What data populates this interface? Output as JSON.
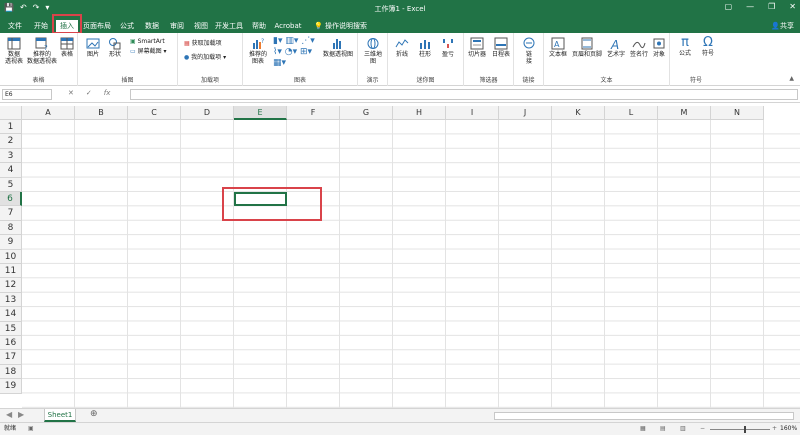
{
  "window": {
    "title": "工作簿1 - Excel"
  },
  "quick_access": {
    "save": "💾",
    "undo": "↶",
    "redo": "↷",
    "more": "▾"
  },
  "window_controls": {
    "options": "▢",
    "minimize": "—",
    "restore": "❐",
    "close": "✕"
  },
  "tabs": [
    "文件",
    "开始",
    "插入",
    "页面布局",
    "公式",
    "数据",
    "审阅",
    "视图",
    "开发工具",
    "帮助",
    "Acrobat"
  ],
  "active_tab": "插入",
  "tell_me": "操作说明搜索",
  "share": "共享",
  "ribbon": {
    "groups": [
      {
        "label": "表格",
        "buttons": [
          "数据\n透视表",
          "推荐的\n数据透视表",
          "表格"
        ]
      },
      {
        "label": "插图",
        "buttons": [
          "图片",
          "形状"
        ],
        "small": [
          "SmartArt",
          "屏幕截图 ▾"
        ]
      },
      {
        "label": "加载项",
        "small": [
          "获取加载项",
          "我的加载项 ▾"
        ]
      },
      {
        "label": "图表",
        "buttons": [
          "推荐的\n图表",
          "数据透视图"
        ]
      },
      {
        "label": "演示",
        "buttons": [
          "三维地\n图"
        ]
      },
      {
        "label": "迷你图",
        "buttons": [
          "折线",
          "柱形",
          "盈亏"
        ]
      },
      {
        "label": "筛选器",
        "buttons": [
          "切片器",
          "日程表"
        ]
      },
      {
        "label": "链接",
        "buttons": [
          "链\n接"
        ]
      },
      {
        "label": "文本",
        "buttons": [
          "文本框",
          "页眉和页脚",
          "艺术字",
          "签名行",
          "对象"
        ]
      },
      {
        "label": "符号",
        "buttons": [
          "公式",
          "符号"
        ]
      }
    ]
  },
  "formula_bar": {
    "name_box": "E6",
    "cancel": "✕",
    "enter": "✓",
    "fx": "fx",
    "value": ""
  },
  "columns": [
    "A",
    "B",
    "C",
    "D",
    "E",
    "F",
    "G",
    "H",
    "I",
    "J",
    "K",
    "L",
    "M",
    "N"
  ],
  "rows": [
    "1",
    "2",
    "3",
    "4",
    "5",
    "6",
    "7",
    "8",
    "9",
    "10",
    "11",
    "12",
    "13",
    "14",
    "15",
    "16",
    "17",
    "18",
    "19"
  ],
  "selected_cell": "E6",
  "sheets": [
    "Sheet1"
  ],
  "add_sheet": "⊕",
  "status": {
    "ready": "就绪",
    "zoom": "160%"
  },
  "colors": {
    "accent": "#217346",
    "highlight": "#d9434a"
  }
}
